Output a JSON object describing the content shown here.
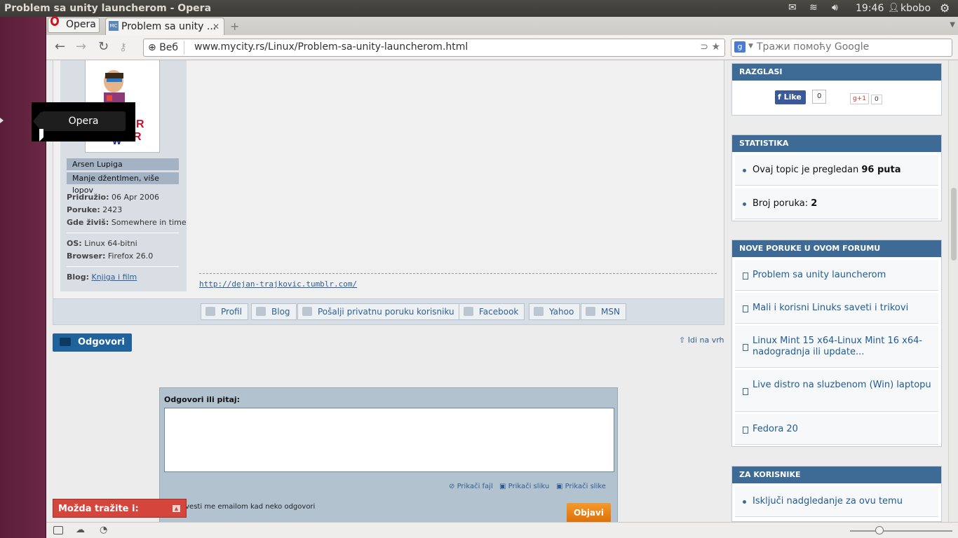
{
  "system": {
    "window_title": "Problem sa unity launcherom - Opera",
    "clock": "19:46",
    "user": "kbobo"
  },
  "launcher": {
    "tooltip": "Opera"
  },
  "browser": {
    "menu_label": "Opera",
    "tab_title": "Problem sa unity ...",
    "address_badge": "Веб",
    "url": "www.mycity.rs/Linux/Problem-sa-unity-launcherom.html",
    "search_placeholder": "Тражи помоћу Google"
  },
  "post": {
    "avatar_text": "R\nR",
    "name_badge": "Arsen Lupiga",
    "rank_badge": "Manje džentlmen, više lopov",
    "joined_label": "Pridružio:",
    "joined_value": "06 Apr 2006",
    "posts_label": "Poruke:",
    "posts_value": "2423",
    "location_label": "Gde živiš:",
    "location_value": "Somewhere in time",
    "os_label": "OS:",
    "os_value": "Linux 64-bitni",
    "browser_label": "Browser:",
    "browser_value": "Firefox 26.0",
    "blog_label": "Blog:",
    "blog_value": "Knjiga i film",
    "signature_url": "http://dejan-trajkovic.tumblr.com/"
  },
  "actions": [
    "Profil",
    "Blog",
    "Pošalji privatnu poruku korisniku",
    "Facebook",
    "Yahoo",
    "MSN"
  ],
  "reply": {
    "button": "Odgovori",
    "top_link": "Idi na vrh",
    "form_label": "Odgovori ili pitaj:",
    "attach_file": "Prikači fajl",
    "attach_image": "Prikači sliku",
    "attach_images": "Prikači slike",
    "notify": "avesti me emailom kad neko odgovori",
    "submit": "Objavi"
  },
  "maybe_banner": "Možda tražite i:",
  "sidebar": {
    "razglasi": {
      "title": "RAZGLASI",
      "fb_label": "Like",
      "fb_count": "0",
      "gplus_label": "+1",
      "gplus_count": "0"
    },
    "statistika": {
      "title": "STATISTIKA",
      "views_prefix": "Ovaj topic je pregledan",
      "views_value": "96 puta",
      "posts_prefix": "Broj poruka:",
      "posts_value": "2"
    },
    "nove_poruke": {
      "title": "NOVE PORUKE U OVOM FORUMU",
      "items": [
        "Problem sa unity launcherom",
        "Mali i korisni Linuks saveti i trikovi",
        "Linux Mint 15 x64-Linux Mint 16 x64-nadogradnja ili update...",
        "Live distro na sluzbenom (Win) laptopu",
        "Fedora 20"
      ]
    },
    "za_korisnike": {
      "title": "ZA KORISNIKE",
      "items": [
        "Isključi nadgledanje za ovu temu"
      ]
    }
  }
}
